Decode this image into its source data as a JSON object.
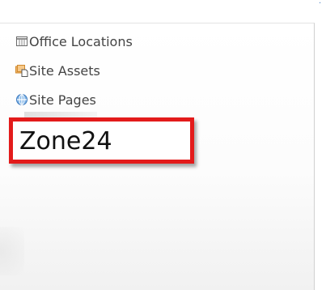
{
  "nav": {
    "items": [
      {
        "label": "Office Locations",
        "icon": "list-icon"
      },
      {
        "label": "Site Assets",
        "icon": "site-assets-icon"
      },
      {
        "label": "Site Pages",
        "icon": "site-pages-icon"
      }
    ]
  },
  "overlay": {
    "zone_label": "Zone24",
    "border_color": "#e31b1b"
  }
}
